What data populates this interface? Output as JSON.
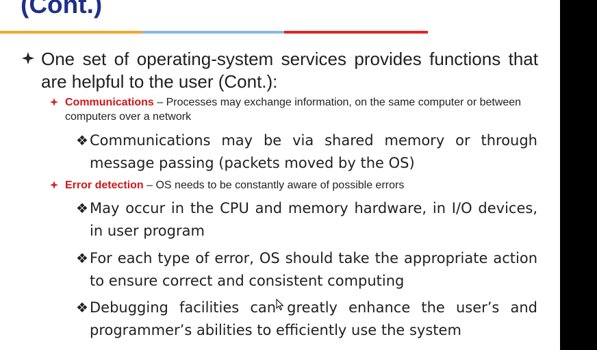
{
  "slide": {
    "title": "(Cont.)",
    "colors": {
      "title": "#1f2f8a",
      "bullet_red": "#d01818",
      "bar_orange": "#f2a72b",
      "bar_blue": "#86b8e2",
      "bar_red": "#e02524"
    },
    "main_bullet": "One set of operating-system services provides functions that are helpful to the user (Cont.):",
    "sections": [
      {
        "heading": "Communications",
        "text": " – Processes may exchange information, on the same computer or between computers over a network",
        "subpoints": [
          "Communications may be via shared memory or through message passing (packets moved by the OS)"
        ]
      },
      {
        "heading": "Error detection",
        "text": " – OS needs to be constantly aware of possible errors",
        "subpoints": [
          "May occur in the CPU and memory hardware, in I/O devices, in user program",
          "For each type of error, OS should take the appropriate action to ensure correct and consistent computing",
          "Debugging facilities can greatly enhance the user’s and programmer’s abilities to efficiently use the system"
        ]
      }
    ]
  }
}
